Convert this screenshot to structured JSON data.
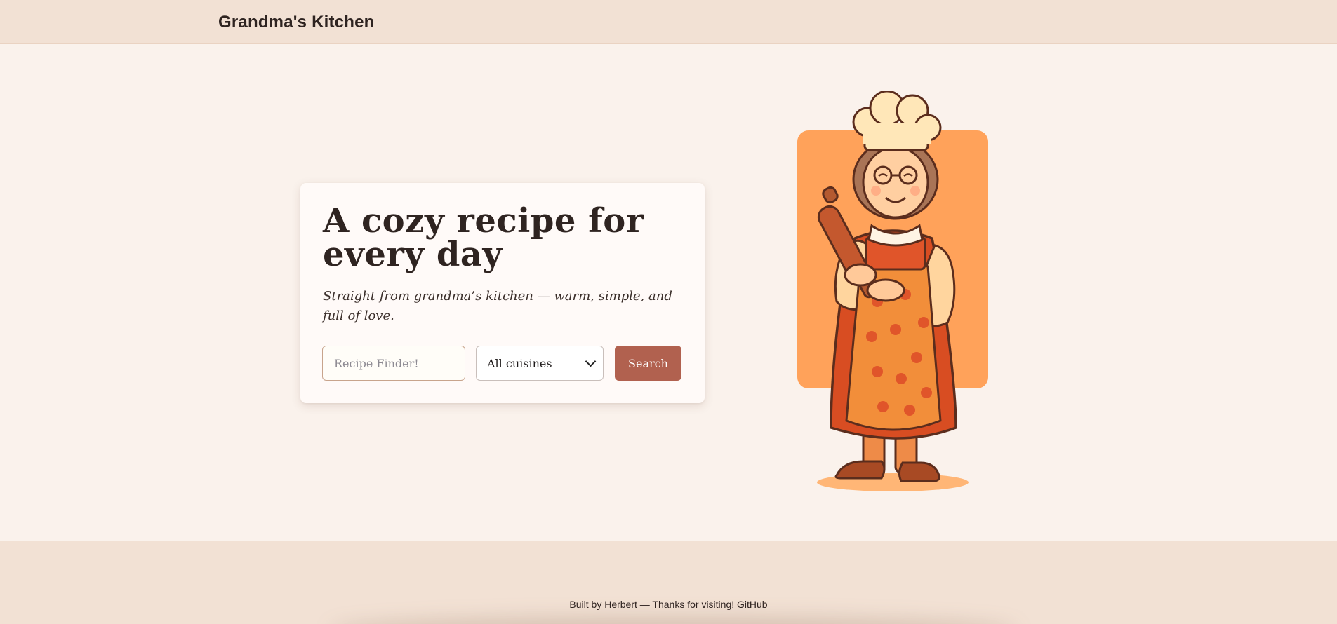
{
  "header": {
    "brand": "Grandma's Kitchen"
  },
  "hero": {
    "title": "A cozy recipe for every day",
    "subtitle": "Straight from grandma’s kitchen — warm, simple, and full of love.",
    "search": {
      "placeholder": "Recipe Finder!",
      "value": ""
    },
    "cuisine_select": {
      "selected": "All cuisines"
    },
    "search_button": "Search",
    "illustration": "grandma-chef-illustration"
  },
  "footer": {
    "text": "Built by Herbert — Thanks for visiting!",
    "link_label": "GitHub"
  },
  "colors": {
    "header_bg": "#f2e1d4",
    "page_bg": "#faf2ec",
    "accent_button": "#b1614f",
    "illustration_panel": "#ffa25a"
  }
}
